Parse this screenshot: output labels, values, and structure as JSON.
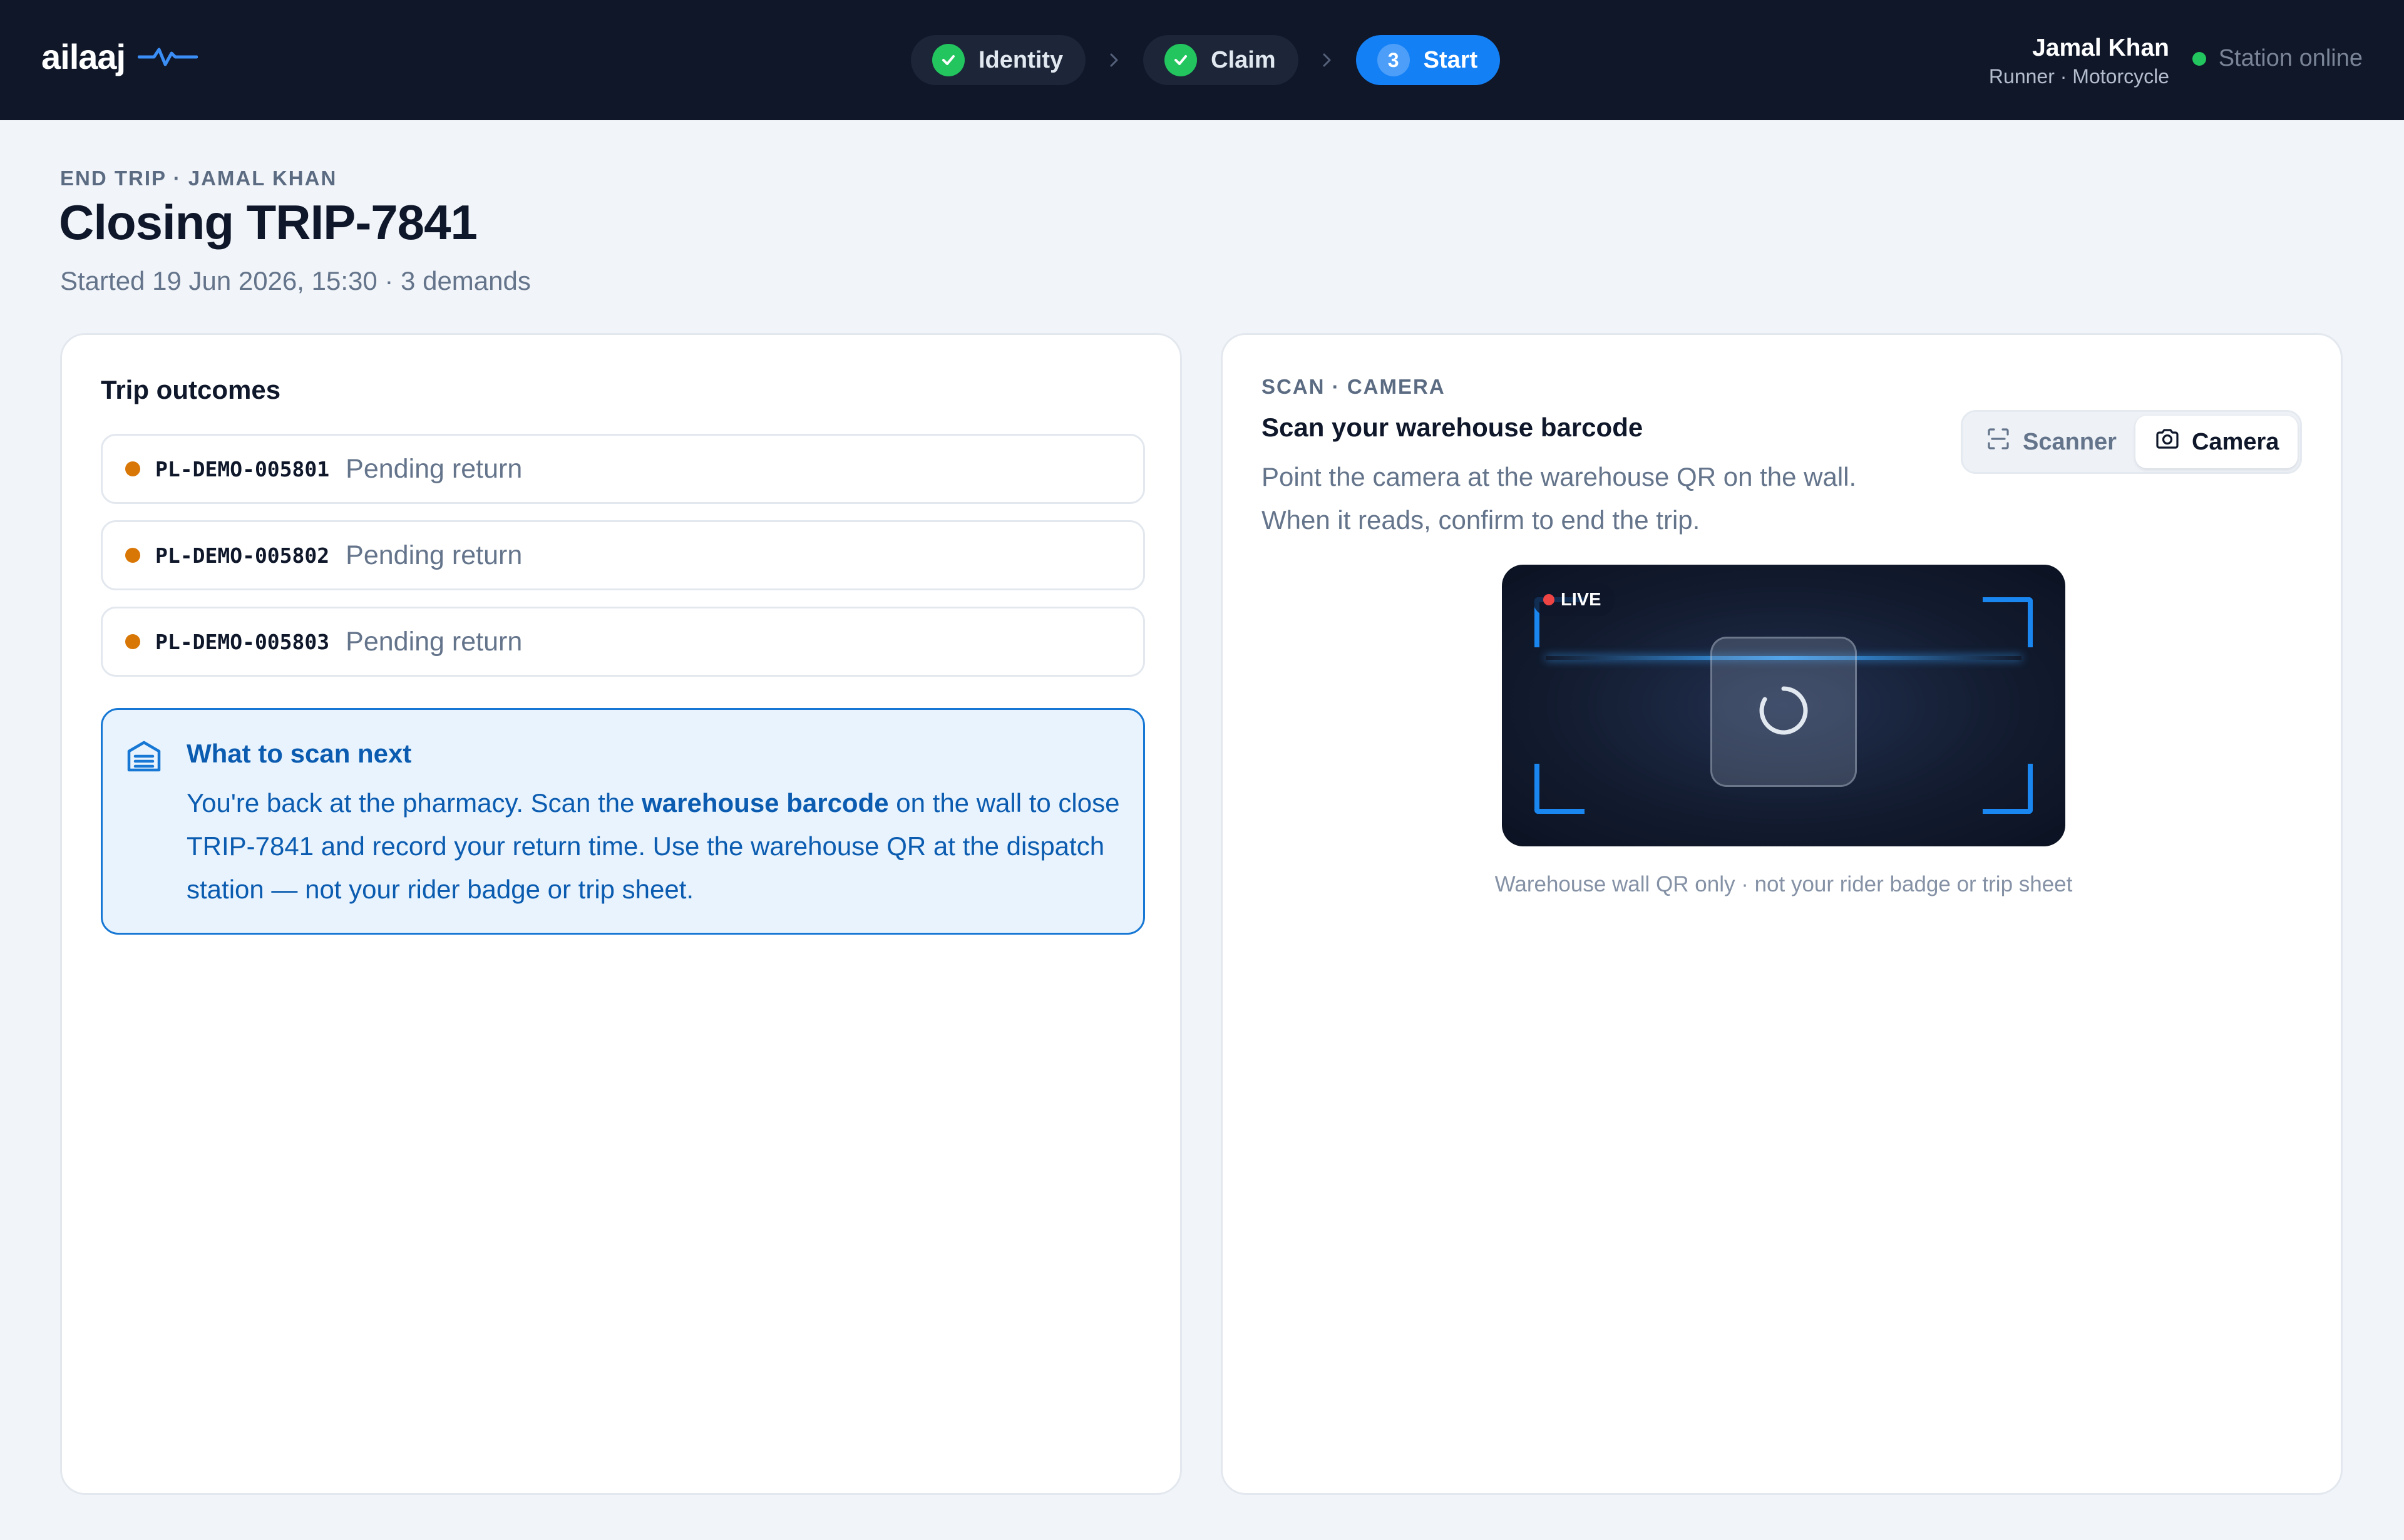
{
  "brand": {
    "name": "ailaaj",
    "pulse_icon": "heartbeat-icon"
  },
  "stepper": [
    {
      "label": "Identity",
      "state": "done"
    },
    {
      "label": "Claim",
      "state": "done"
    },
    {
      "label": "Start",
      "state": "active",
      "number": "3"
    }
  ],
  "user": {
    "name": "Jamal Khan",
    "role": "Runner · Motorcycle"
  },
  "station": {
    "status": "Station online",
    "color": "#22c55e"
  },
  "header": {
    "eyebrow": "END TRIP · JAMAL KHAN",
    "title": "Closing TRIP-7841",
    "subtitle": "Started 19 Jun 2026, 15:30 · 3 demands"
  },
  "outcomes": {
    "heading": "Trip outcomes",
    "items": [
      {
        "id": "PL-DEMO-005801",
        "status": "Pending return"
      },
      {
        "id": "PL-DEMO-005802",
        "status": "Pending return"
      },
      {
        "id": "PL-DEMO-005803",
        "status": "Pending return"
      }
    ],
    "status_color": "#d97706"
  },
  "hint": {
    "title": "What to scan next",
    "body_pre": "You're back at the pharmacy. Scan the ",
    "body_emphasis": "warehouse barcode",
    "body_post": " on the wall to close TRIP-7841 and record your return time. Use the warehouse QR at the dispatch station — not your rider badge or trip sheet.",
    "icon": "warehouse-icon"
  },
  "scan": {
    "eyebrow": "SCAN · CAMERA",
    "title": "Scan your warehouse barcode",
    "description_line1": "Point the camera at the warehouse QR on the wall.",
    "description_line2": "When it reads, confirm to end the trip.",
    "modes": [
      {
        "label": "Scanner",
        "icon": "scanner-icon",
        "active": false
      },
      {
        "label": "Camera",
        "icon": "camera-icon",
        "active": true
      }
    ],
    "live_label": "LIVE",
    "caption": "Warehouse wall QR only · not your rider badge or trip sheet"
  },
  "colors": {
    "accent": "#1480f5",
    "topbar": "#0f1729",
    "hint_text": "#0b5cb0"
  }
}
